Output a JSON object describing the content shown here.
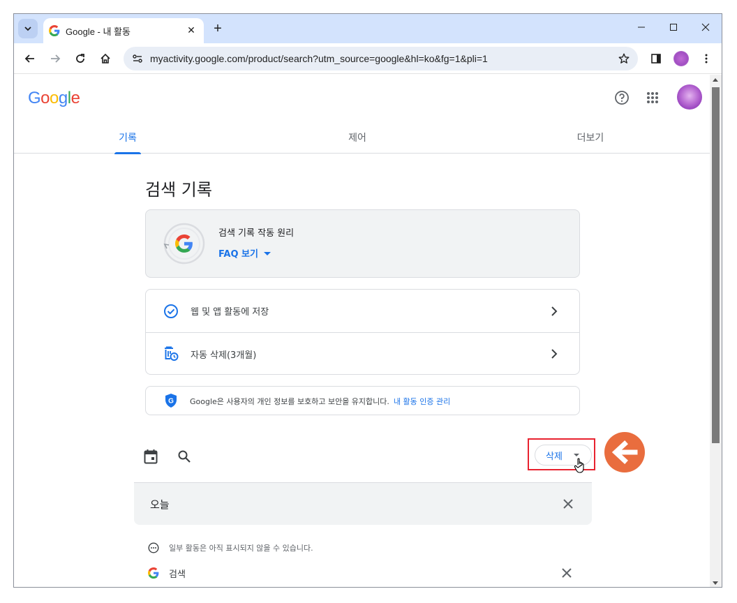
{
  "browser": {
    "tab_title": "Google - 내 활동",
    "url": "myactivity.google.com/product/search?utm_source=google&hl=ko&fg=1&pli=1"
  },
  "header": {
    "logo_text": "Google",
    "logo_colors": [
      "#4285F4",
      "#EA4335",
      "#FBBC05",
      "#4285F4",
      "#34A853",
      "#EA4335"
    ]
  },
  "nav_tabs": [
    {
      "label": "기록",
      "active": true
    },
    {
      "label": "제어",
      "active": false
    },
    {
      "label": "더보기",
      "active": false
    }
  ],
  "page_title": "검색 기록",
  "faq_card": {
    "title": "검색 기록 작동 원리",
    "link": "FAQ 보기"
  },
  "settings": [
    {
      "label": "웹 및 앱 활동에 저장",
      "icon": "check-circle-icon"
    },
    {
      "label": "자동 삭제(3개월)",
      "icon": "auto-delete-icon"
    }
  ],
  "privacy": {
    "text": "Google은 사용자의 개인 정보를 보호하고 보안을 유지합니다.",
    "link": "내 활동 인증 관리"
  },
  "filters": {
    "delete_label": "삭제"
  },
  "day_group": {
    "label": "오늘"
  },
  "notice": "일부 활동은 아직 표시되지 않을 수 있습니다.",
  "items": [
    {
      "label": "검색"
    }
  ],
  "colors": {
    "accent": "#1a73e8",
    "annotation": "#e96d3e",
    "highlight_box": "#e8222f"
  }
}
